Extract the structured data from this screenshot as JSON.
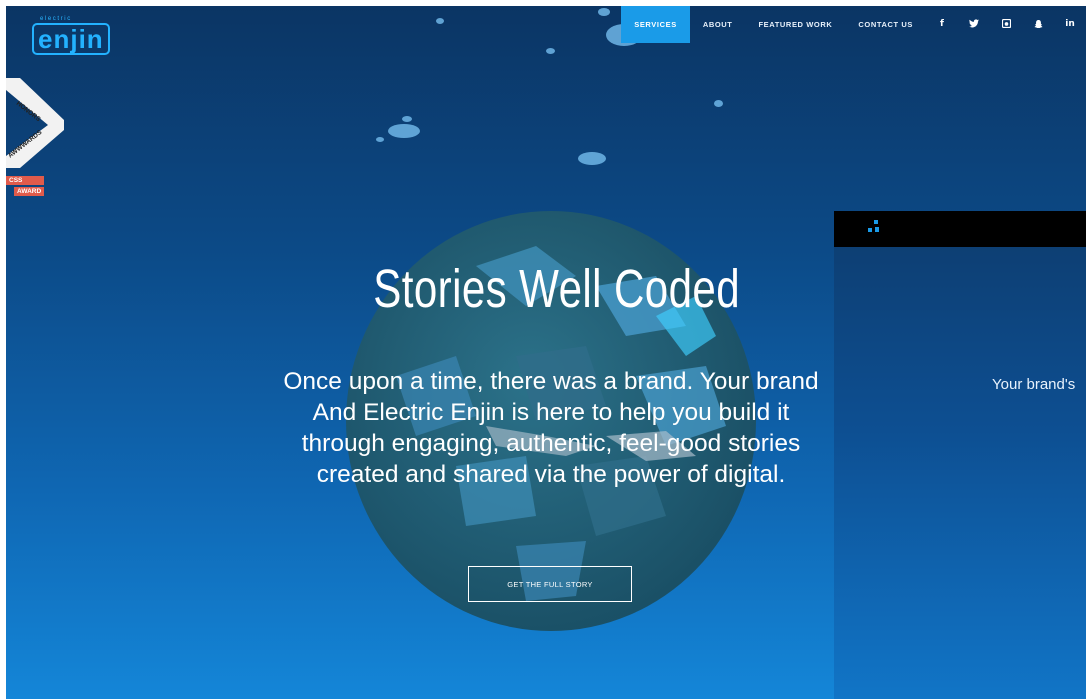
{
  "logo": {
    "small_text": "electric",
    "big_text": "enjin"
  },
  "nav": {
    "items": [
      {
        "label": "SERVICES",
        "active": true
      },
      {
        "label": "ABOUT",
        "active": false
      },
      {
        "label": "FEATURED WORK",
        "active": false
      },
      {
        "label": "CONTACT US",
        "active": false
      }
    ],
    "social": [
      {
        "icon": "facebook-icon",
        "glyph": "f"
      },
      {
        "icon": "twitter-icon",
        "glyph": "🐦"
      },
      {
        "icon": "instagram-icon",
        "glyph": "◙"
      },
      {
        "icon": "snapchat-icon",
        "glyph": "♟"
      },
      {
        "icon": "linkedin-icon",
        "glyph": "in"
      }
    ]
  },
  "badges": {
    "awwwards_top": "HONORS",
    "awwwards_bottom": "AWWWARDS",
    "css_line1": "CSS",
    "css_line2": "AWARD"
  },
  "hero": {
    "title": "Stories Well Coded",
    "body_lines": [
      "Once upon a time, there was a brand. Your brand",
      "And Electric Enjin is here to help you build it",
      "through engaging, authentic, feel-good stories",
      "created and shared via the power of digital."
    ],
    "cta_label": "GET THE FULL STORY"
  },
  "side_panel": {
    "text": "Your brand's"
  },
  "colors": {
    "accent": "#1a9be8",
    "logo": "#23b2ff",
    "badge_red": "#e05b4b",
    "panel_bar": "#000000"
  }
}
